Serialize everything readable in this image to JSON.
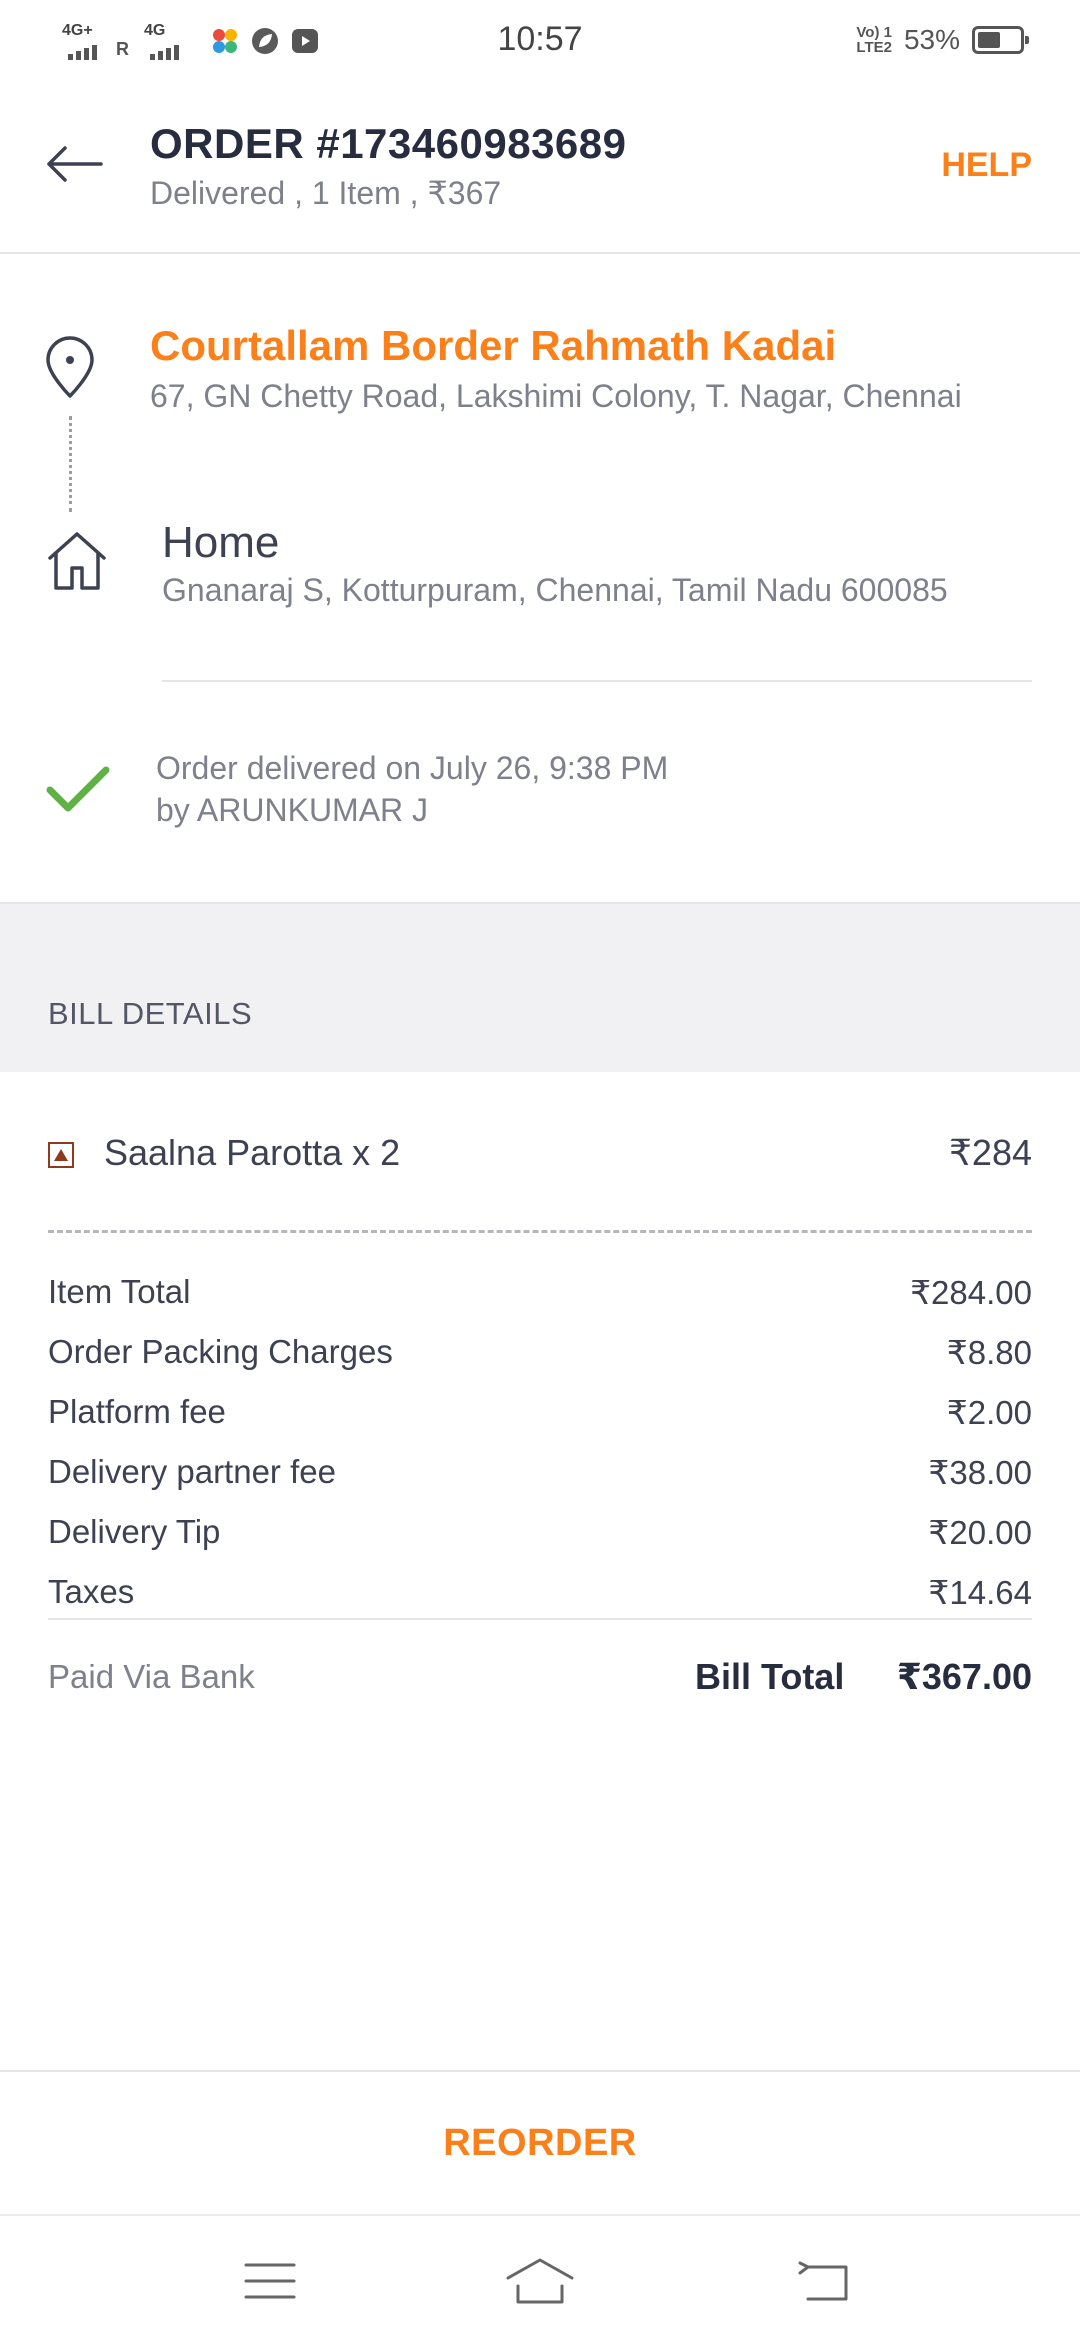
{
  "status_bar": {
    "network1": "4G+",
    "network2": "4G",
    "roaming": "R",
    "time": "10:57",
    "volte": "Vo) 1\nLTE2",
    "battery": "53%"
  },
  "header": {
    "title": "ORDER #173460983689",
    "subtitle": "Delivered , 1 Item , ₹367",
    "help_label": "HELP"
  },
  "route": {
    "restaurant_name": "Courtallam Border Rahmath Kadai",
    "restaurant_address": "67, GN Chetty Road, Lakshimi Colony, T. Nagar, Chennai",
    "destination_label": "Home",
    "destination_address": "Gnanaraj S, Kotturpuram, Chennai, Tamil Nadu 600085",
    "delivered_text": "Order delivered on July 26, 9:38 PM",
    "delivered_by": "by ARUNKUMAR J"
  },
  "bill": {
    "heading": "BILL DETAILS",
    "items": [
      {
        "name": "Saalna Parotta x 2",
        "price": "₹284"
      }
    ],
    "charges": [
      {
        "label": "Item Total",
        "value": "₹284.00"
      },
      {
        "label": "Order Packing Charges",
        "value": "₹8.80"
      },
      {
        "label": "Platform fee",
        "value": "₹2.00"
      },
      {
        "label": "Delivery partner fee",
        "value": "₹38.00"
      },
      {
        "label": "Delivery Tip",
        "value": "₹20.00"
      },
      {
        "label": "Taxes",
        "value": "₹14.64"
      }
    ],
    "paid_via": "Paid Via Bank",
    "total_label": "Bill Total",
    "total_value": "₹367.00"
  },
  "reorder_label": "REORDER",
  "colors": {
    "accent": "#fc8019",
    "check": "#60b246",
    "dark_text": "#282c3f",
    "muted_text": "#7e808c"
  },
  "icons": {
    "back": "arrow-left-icon",
    "pin": "location-pin-icon",
    "home": "home-icon",
    "check": "check-icon",
    "veg_mark": "non-veg-mark-icon",
    "nav_menu": "menu-icon",
    "nav_home": "home-nav-icon",
    "nav_back": "back-nav-icon"
  }
}
